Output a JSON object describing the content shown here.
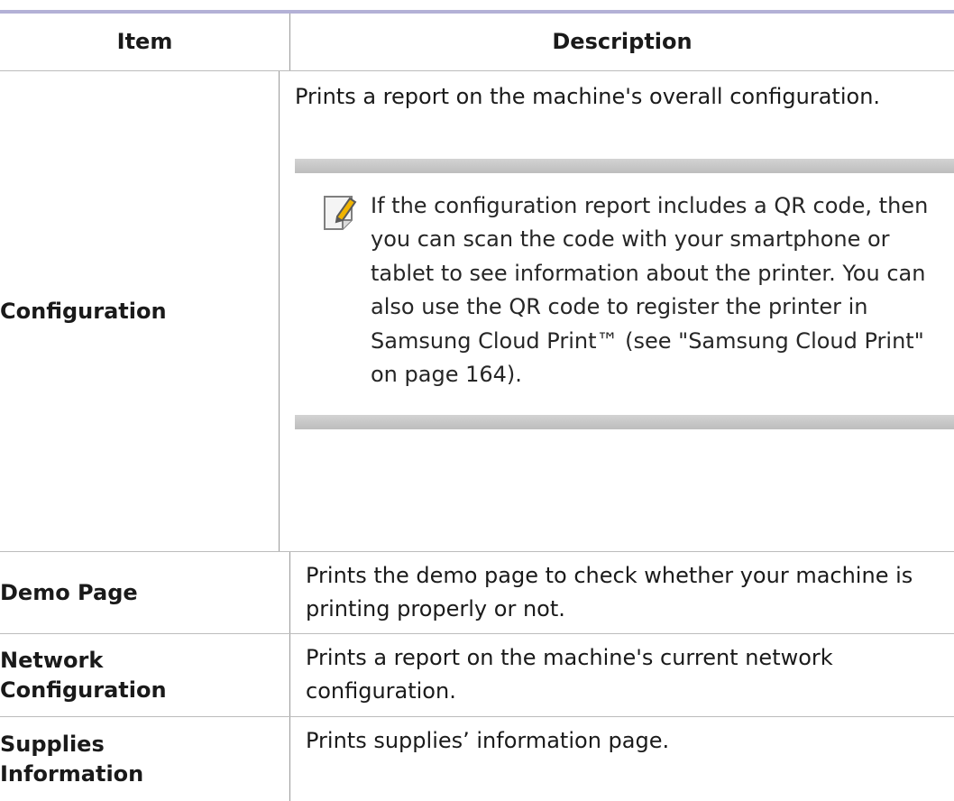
{
  "table": {
    "header": {
      "item": "Item",
      "description": "Description"
    },
    "rows": [
      {
        "item": "Configuration",
        "description": "Prints a report on the machine's overall configuration.",
        "note": {
          "icon": "note-pencil-icon",
          "text": "If the configuration report includes a QR code, then you can scan the code with your smartphone or tablet to see information about the printer. You can also use the QR code to register the printer in Samsung Cloud Print™ (see \"Samsung Cloud Print\" on page 164)."
        }
      },
      {
        "item": "Demo Page",
        "description": "Prints the demo page to check whether your machine is printing properly or not."
      },
      {
        "item_line1": "Network",
        "item_line2": "Configuration",
        "description": "Prints a report on the machine's current network configuration."
      },
      {
        "item_line1": "Supplies",
        "item_line2": "Information",
        "description": "Prints supplies’ information page."
      }
    ]
  },
  "colors": {
    "header_rule": "#b3b1d6",
    "note_bar": "#c8c8c8",
    "icon_accent": "#f0b400"
  }
}
